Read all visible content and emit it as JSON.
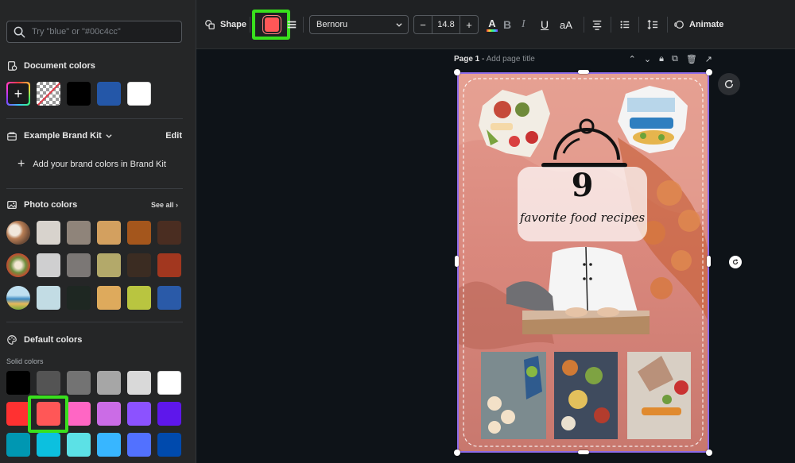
{
  "search": {
    "placeholder": "Try \"blue\" or \"#00c4cc\""
  },
  "document_colors": {
    "title": "Document colors",
    "swatches": [
      "#000000",
      "#2457a8",
      "#ffffff"
    ]
  },
  "brand_kit": {
    "title": "Example Brand Kit",
    "edit_label": "Edit",
    "add_label": "Add your brand colors in Brand Kit"
  },
  "photo_colors": {
    "title": "Photo colors",
    "see_all": "See all",
    "rows": [
      [
        "#d8d3cd",
        "#8f847a",
        "#d3a05f",
        "#a4561c",
        "#4a2d21"
      ],
      [
        "#cfcfd0",
        "#7b7775",
        "#b3a96a",
        "#3b2c22",
        "#a2371f"
      ],
      [
        "#c2dce4",
        "#1e2722",
        "#deaa5c",
        "#b9c540",
        "#2a5aa8"
      ]
    ]
  },
  "default_colors": {
    "title": "Default colors",
    "subtitle": "Solid colors",
    "rows": [
      [
        "#000000",
        "#545454",
        "#737373",
        "#a6a6a6",
        "#d9d9d9",
        "#ffffff"
      ],
      [
        "#ff3131",
        "#ff5757",
        "#ff66c4",
        "#cb6ce6",
        "#8c52ff",
        "#5e17eb"
      ],
      [
        "#0097b2",
        "#0cc0df",
        "#5ce1e6",
        "#38b6ff",
        "#5271ff",
        "#004aad"
      ]
    ]
  },
  "toolbar": {
    "shape_label": "Shape",
    "selected_color": "#ff5757",
    "font_name": "Bernoru",
    "font_size": "14.8",
    "animate_label": "Animate"
  },
  "page": {
    "label": "Page 1",
    "subtitle": "Add page title"
  },
  "design": {
    "number": "9",
    "tagline": "favorite food recipes"
  },
  "colors": {
    "highlight": "#39e01d",
    "selection": "#8e6be8"
  }
}
